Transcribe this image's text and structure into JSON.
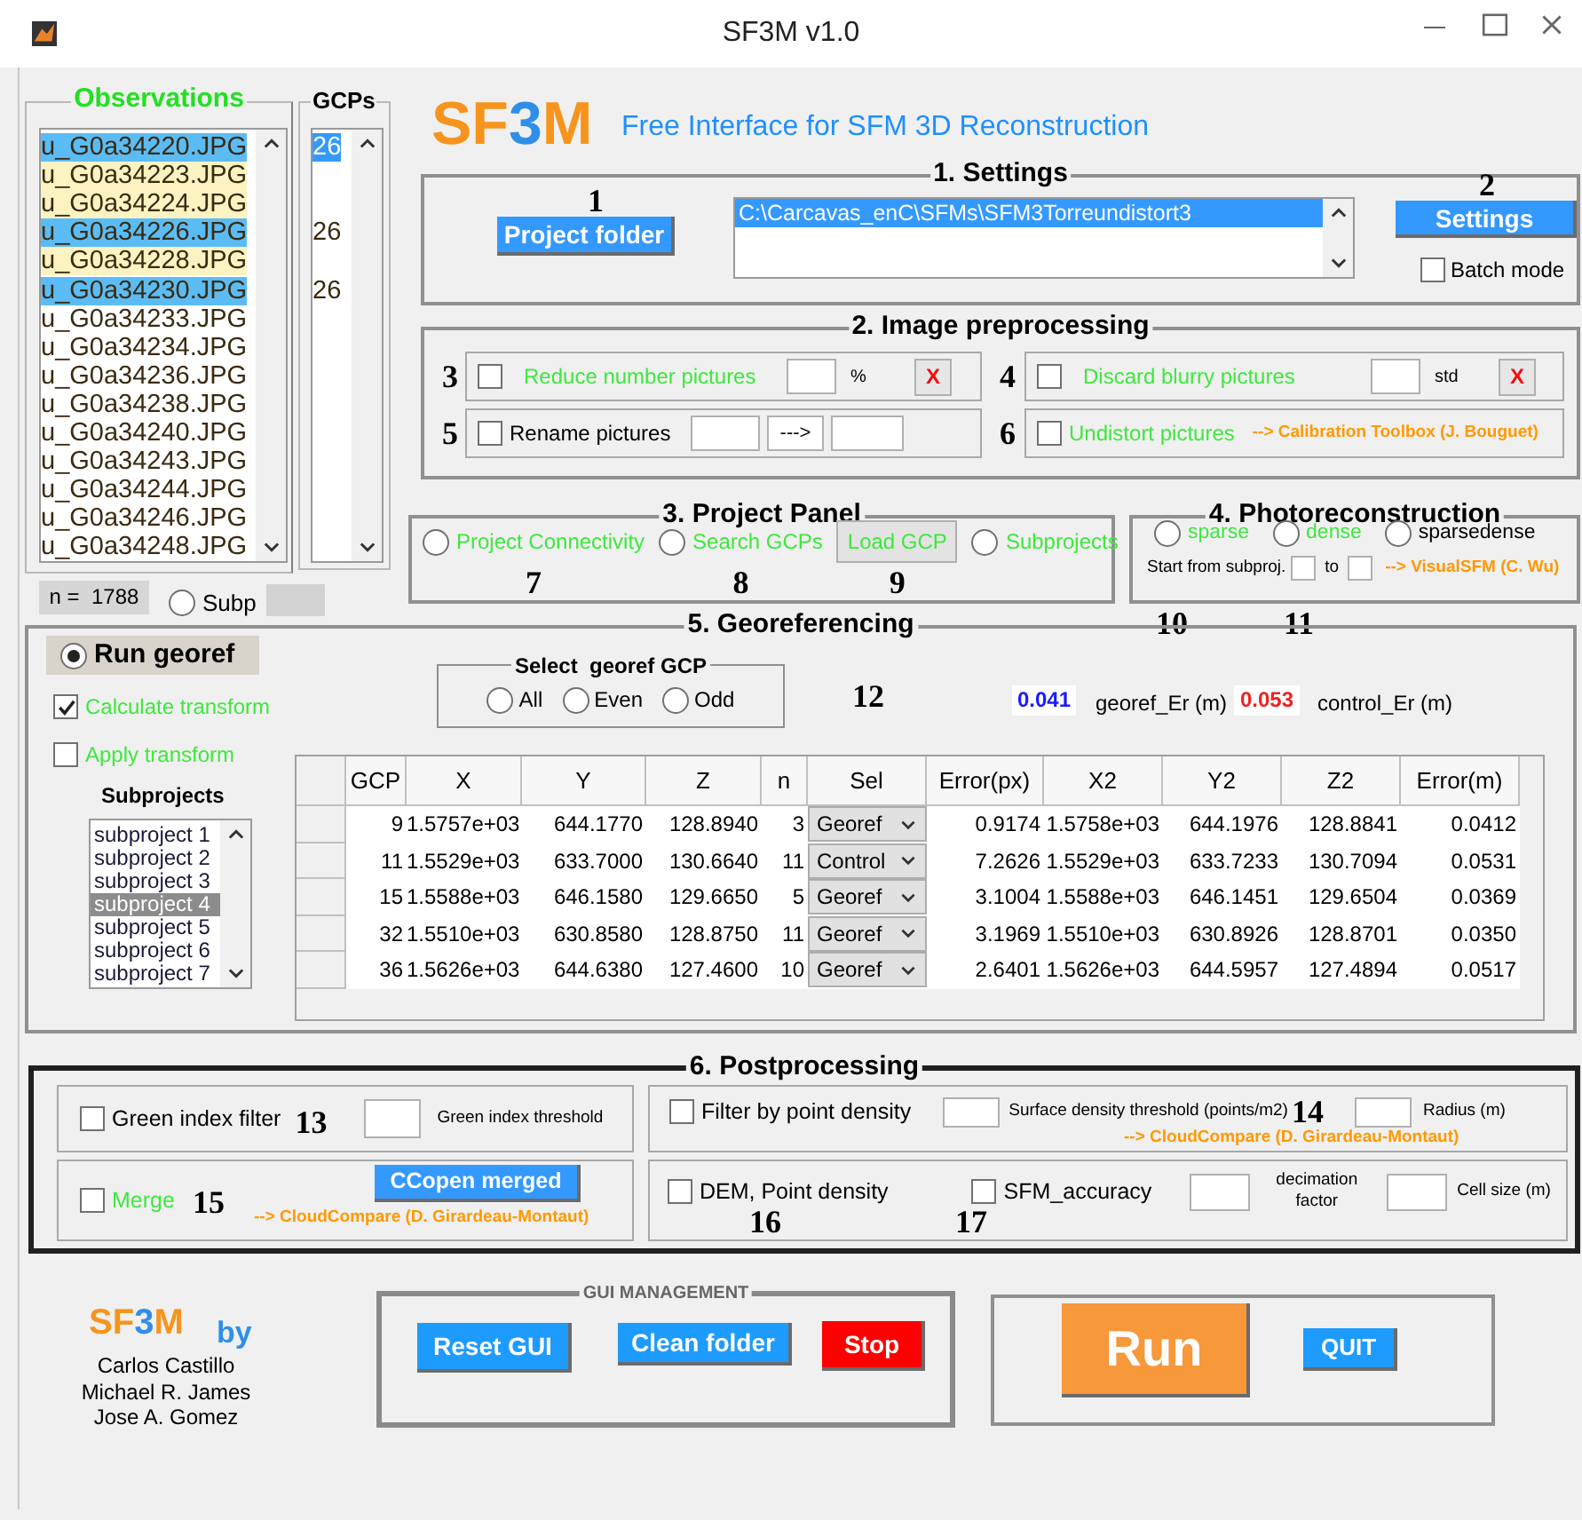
{
  "window": {
    "title": "SF3M v1.0"
  },
  "observations": {
    "title": "Observations",
    "gcps_title": "GCPs",
    "items": [
      {
        "text": "u_G0a34220.JPG",
        "selected": true,
        "gcp": "26",
        "gcp_selected": true
      },
      {
        "text": "u_G0a34223.JPG",
        "selected": false,
        "marked": true
      },
      {
        "text": "u_G0a34224.JPG",
        "selected": false,
        "marked": true
      },
      {
        "text": "u_G0a34226.JPG",
        "selected": true,
        "gcp": "26",
        "gcp_selected": false
      },
      {
        "text": "u_G0a34228.JPG",
        "selected": false,
        "marked": true
      },
      {
        "text": "u_G0a34230.JPG",
        "selected": true,
        "gcp": "26",
        "gcp_selected": false
      },
      {
        "text": "u_G0a34233.JPG",
        "selected": false,
        "marked": false
      },
      {
        "text": "u_G0a34234.JPG",
        "selected": false,
        "marked": false
      },
      {
        "text": "u_G0a34236.JPG",
        "selected": false,
        "marked": false
      },
      {
        "text": "u_G0a34238.JPG",
        "selected": false,
        "marked": false
      },
      {
        "text": "u_G0a34240.JPG",
        "selected": false,
        "marked": false
      },
      {
        "text": "u_G0a34243.JPG",
        "selected": false,
        "marked": false
      },
      {
        "text": "u_G0a34244.JPG",
        "selected": false,
        "marked": false
      },
      {
        "text": "u_G0a34246.JPG",
        "selected": false,
        "marked": false
      },
      {
        "text": "u_G0a34248.JPG",
        "selected": false,
        "marked": false
      }
    ],
    "count": "n =  1788",
    "subp": {
      "label": "Subp",
      "selected": false
    }
  },
  "header": {
    "logo": [
      "SF",
      "3",
      "M"
    ],
    "subtitle": "Free Interface for SFM 3D Reconstruction"
  },
  "settings": {
    "title": "1. Settings",
    "marker": "1",
    "project_button": "Project folder",
    "paths": [
      {
        "text": "C:\\Carcavas_enC\\SFMs\\SFM3Torreundistort3",
        "selected": true
      }
    ],
    "settings_marker": "2",
    "settings_button": "Settings",
    "batch": {
      "label": "Batch mode",
      "checked": false
    }
  },
  "preprocessing": {
    "title": "2. Image preprocessing",
    "options": [
      {
        "kind": "reduce",
        "marker": "3",
        "label": "Reduce number pictures",
        "checked": false,
        "highlighted": true,
        "unit": "%",
        "clear": "X"
      },
      {
        "kind": "blurry",
        "marker": "4",
        "label": "Discard blurry pictures",
        "checked": false,
        "highlighted": true,
        "unit": "std",
        "clear": "X"
      },
      {
        "kind": "rename",
        "marker": "5",
        "label": "Rename pictures",
        "checked": false,
        "highlighted": false,
        "arrow": "--->"
      },
      {
        "kind": "undistort",
        "marker": "6",
        "label": "Undistort pictures",
        "checked": false,
        "highlighted": true,
        "link": "--> Calibration Toolbox (J. Bouguet)"
      }
    ]
  },
  "project_panel": {
    "title": "3. Project Panel",
    "items": [
      {
        "kind": "radio",
        "label": "Project Connectivity",
        "marker": "7",
        "selected": false,
        "highlighted": true
      },
      {
        "kind": "radio",
        "label": "Search GCPs",
        "marker": "8",
        "selected": false,
        "highlighted": true
      },
      {
        "kind": "button",
        "label": "Load GCP",
        "marker": "9",
        "highlighted": true
      },
      {
        "kind": "radio",
        "label": "Subprojects",
        "selected": false,
        "highlighted": true
      }
    ]
  },
  "photoreconstruction": {
    "title": "4. Photoreconstruction",
    "modes": [
      {
        "label": "sparse",
        "selected": false,
        "highlighted": true
      },
      {
        "label": "dense",
        "selected": false,
        "highlighted": true
      },
      {
        "label": "sparsedense",
        "selected": false,
        "highlighted": false
      }
    ],
    "start_label": "Start from subproj.",
    "to_label": "to",
    "link": "--> VisualSFM (C. Wu)",
    "markers": [
      "10",
      "11"
    ]
  },
  "georeferencing": {
    "title": "5. Georeferencing",
    "run": {
      "label": "Run georef",
      "selected": true
    },
    "calculate": {
      "label": "Calculate transform",
      "checked": true
    },
    "apply": {
      "label": "Apply transform",
      "checked": false
    },
    "subprojects": {
      "title": "Subprojects",
      "items": [
        {
          "text": "subproject 1",
          "selected": false
        },
        {
          "text": "subproject 2",
          "selected": false
        },
        {
          "text": "subproject 3",
          "selected": false
        },
        {
          "text": "subproject 4",
          "selected": true
        },
        {
          "text": "subproject 5",
          "selected": false
        },
        {
          "text": "subproject 6",
          "selected": false
        },
        {
          "text": "subproject 7",
          "selected": false
        }
      ]
    },
    "select": {
      "title": "Select  georef GCP",
      "options": [
        {
          "label": "All",
          "selected": false
        },
        {
          "label": "Even",
          "selected": false
        },
        {
          "label": "Odd",
          "selected": false
        }
      ]
    },
    "marker": "12",
    "georef_error": {
      "value": "0.041",
      "label": "georef_Er (m)"
    },
    "control_error": {
      "value": "0.053",
      "label": "control_Er (m)"
    },
    "table": {
      "columns": [
        "GCP",
        "X",
        "Y",
        "Z",
        "n",
        "Sel",
        "Error(px)",
        "X2",
        "Y2",
        "Z2",
        "Error(m)"
      ],
      "rows": [
        [
          "9",
          "1.5757e+03",
          "644.1770",
          "128.8940",
          "3",
          "Georef",
          "0.9174",
          "1.5758e+03",
          "644.1976",
          "128.8841",
          "0.0412"
        ],
        [
          "11",
          "1.5529e+03",
          "633.7000",
          "130.6640",
          "11",
          "Control",
          "7.2626",
          "1.5529e+03",
          "633.7233",
          "130.7094",
          "0.0531"
        ],
        [
          "15",
          "1.5588e+03",
          "646.1580",
          "129.6650",
          "5",
          "Georef",
          "3.1004",
          "1.5588e+03",
          "646.1451",
          "129.6504",
          "0.0369"
        ],
        [
          "32",
          "1.5510e+03",
          "630.8580",
          "128.8750",
          "11",
          "Georef",
          "3.1969",
          "1.5510e+03",
          "630.8926",
          "128.8701",
          "0.0350"
        ],
        [
          "36",
          "1.5626e+03",
          "644.6380",
          "127.4600",
          "10",
          "Georef",
          "2.6401",
          "1.5626e+03",
          "644.5957",
          "127.4894",
          "0.0517"
        ]
      ]
    }
  },
  "postprocessing": {
    "title": "6. Postprocessing",
    "green_filter": {
      "label": "Green index filter",
      "checked": false,
      "marker": "13",
      "threshold_label": "Green index threshold"
    },
    "density_filter": {
      "label": "Filter by point density",
      "checked": false,
      "threshold_label": "Surface density threshold (points/m2)",
      "marker": "14",
      "radius_label": "Radius (m)",
      "link": "--> CloudCompare (D. Girardeau-Montaut)"
    },
    "merge": {
      "label": "Merge",
      "checked": false,
      "highlighted": true,
      "marker": "15",
      "button": "CCopen merged",
      "link": "--> CloudCompare (D. Girardeau-Montaut)"
    },
    "dem": {
      "label": "DEM, Point density",
      "checked": false,
      "marker": "16"
    },
    "accuracy": {
      "label": "SFM_accuracy",
      "checked": false,
      "marker": "17",
      "decimation_label": "decimation factor",
      "cell_label": "Cell size (m)"
    }
  },
  "credits": {
    "logo": [
      "SF",
      "3",
      "M"
    ],
    "by": "by",
    "authors": [
      "Carlos Castillo",
      "Michael R. James",
      "Jose A. Gomez"
    ]
  },
  "gui_management": {
    "title": "GUI MANAGEMENT",
    "buttons": [
      {
        "label": "Reset GUI",
        "kind": "normal"
      },
      {
        "label": "Clean folder",
        "kind": "normal"
      },
      {
        "label": "Stop",
        "kind": "danger"
      }
    ]
  },
  "run": {
    "run_button": "Run",
    "quit_button": "QUIT"
  }
}
